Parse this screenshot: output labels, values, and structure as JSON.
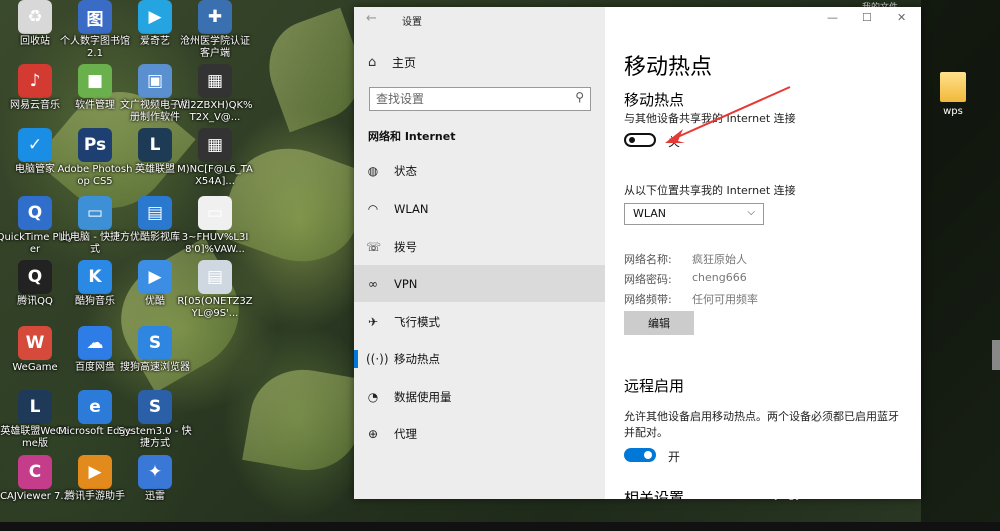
{
  "desktop": {
    "icons": [
      {
        "label": "回收站",
        "color": "#d8d8d8",
        "glyph": "♻"
      },
      {
        "label": "网易云音乐",
        "color": "#d33a31",
        "glyph": "♪"
      },
      {
        "label": "电脑管家",
        "color": "#1a8de4",
        "glyph": "✓"
      },
      {
        "label": "QuickTime Player",
        "color": "#2f6fcb",
        "glyph": "Q"
      },
      {
        "label": "腾讯QQ",
        "color": "#222222",
        "glyph": "Q"
      },
      {
        "label": "WeGame",
        "color": "#d54a3a",
        "glyph": "W"
      },
      {
        "label": "英雄联盟WeGame版",
        "color": "#1f3a58",
        "glyph": "L"
      },
      {
        "label": "CAJViewer 7.2",
        "color": "#c43c8a",
        "glyph": "C"
      },
      {
        "label": "个人数字图书馆2.1",
        "color": "#3a6cc6",
        "glyph": "图"
      },
      {
        "label": "软件管理",
        "color": "#6ab04c",
        "glyph": "■"
      },
      {
        "label": "Adobe Photoshop CS5",
        "color": "#1d3f72",
        "glyph": "Ps"
      },
      {
        "label": "此电脑 - 快捷方式",
        "color": "#3d8fd6",
        "glyph": "▭"
      },
      {
        "label": "酷狗音乐",
        "color": "#2b89e6",
        "glyph": "K"
      },
      {
        "label": "百度网盘",
        "color": "#2e7ce6",
        "glyph": "☁"
      },
      {
        "label": "Microsoft Edge",
        "color": "#2c7bd9",
        "glyph": "e"
      },
      {
        "label": "腾讯手游助手",
        "color": "#e38a1c",
        "glyph": "▶"
      },
      {
        "label": "爱奇艺",
        "color": "#24a4e0",
        "glyph": "▶"
      },
      {
        "label": "文广视频电子相册制作软件",
        "color": "#5a8fd0",
        "glyph": "▣"
      },
      {
        "label": "英雄联盟",
        "color": "#1e3b55",
        "glyph": "L"
      },
      {
        "label": "优酷影视库",
        "color": "#2a79cf",
        "glyph": "▤"
      },
      {
        "label": "优酷",
        "color": "#3b8ee3",
        "glyph": "▶"
      },
      {
        "label": "搜狗高速浏览器",
        "color": "#2f86e0",
        "glyph": "S"
      },
      {
        "label": "System3.0 - 快捷方式",
        "color": "#2b5fa8",
        "glyph": "S"
      },
      {
        "label": "迅雷",
        "color": "#3a78d8",
        "glyph": "✦"
      },
      {
        "label": "沧州医学院认证客户端",
        "color": "#3a6fb0",
        "glyph": "✚"
      },
      {
        "label": "WI2ZBXH)QK%T2X_V@...",
        "color": "#333333",
        "glyph": "▦"
      },
      {
        "label": "M)NC[F@L6_TAX54A]...",
        "color": "#333333",
        "glyph": "▦"
      },
      {
        "label": "3~FHUV%L3I8'0]%VAW...",
        "color": "#f0f0f0",
        "glyph": "▭"
      },
      {
        "label": "R[05(ONETZ3ZYL@9S'...",
        "color": "#cfd8e0",
        "glyph": "▤"
      }
    ],
    "wps_label": "wps",
    "top_partial": "我的文件",
    "watermark": "Bai du 经验",
    "watermark_url": "jingyan.baidu.com"
  },
  "window": {
    "title": "设置",
    "back_icon": "←",
    "controls": {
      "minimize": "—",
      "maximize": "☐",
      "close": "✕"
    }
  },
  "sidebar": {
    "home_label": "主页",
    "search_placeholder": "查找设置",
    "section_title": "网络和 Internet",
    "items": [
      {
        "label": "状态",
        "icon": "globe-status-icon"
      },
      {
        "label": "WLAN",
        "icon": "wifi-icon"
      },
      {
        "label": "拨号",
        "icon": "dialup-icon"
      },
      {
        "label": "VPN",
        "icon": "vpn-icon"
      },
      {
        "label": "飞行模式",
        "icon": "airplane-icon"
      },
      {
        "label": "移动热点",
        "icon": "hotspot-icon"
      },
      {
        "label": "数据使用量",
        "icon": "data-usage-icon"
      },
      {
        "label": "代理",
        "icon": "proxy-globe-icon"
      }
    ],
    "hover_index": 3,
    "selected_index": 5
  },
  "content": {
    "page_title": "移动热点",
    "hotspot": {
      "heading": "移动热点",
      "description": "与其他设备共享我的 Internet 连接",
      "toggle_state": "关"
    },
    "share_from": {
      "label": "从以下位置共享我的 Internet 连接",
      "selected": "WLAN"
    },
    "network": {
      "name_label": "网络名称:",
      "name_value": "疯狂原始人",
      "password_label": "网络密码:",
      "password_value": "cheng666",
      "band_label": "网络频带:",
      "band_value": "任何可用频率"
    },
    "edit_button": "编辑",
    "remote": {
      "heading": "远程启用",
      "description": "允许其他设备启用移动热点。两个设备必须都已启用蓝牙并配对。",
      "toggle_state": "开"
    },
    "related": "相关设置"
  },
  "colors": {
    "accent": "#0078d7",
    "annotation_arrow": "#e53935"
  }
}
